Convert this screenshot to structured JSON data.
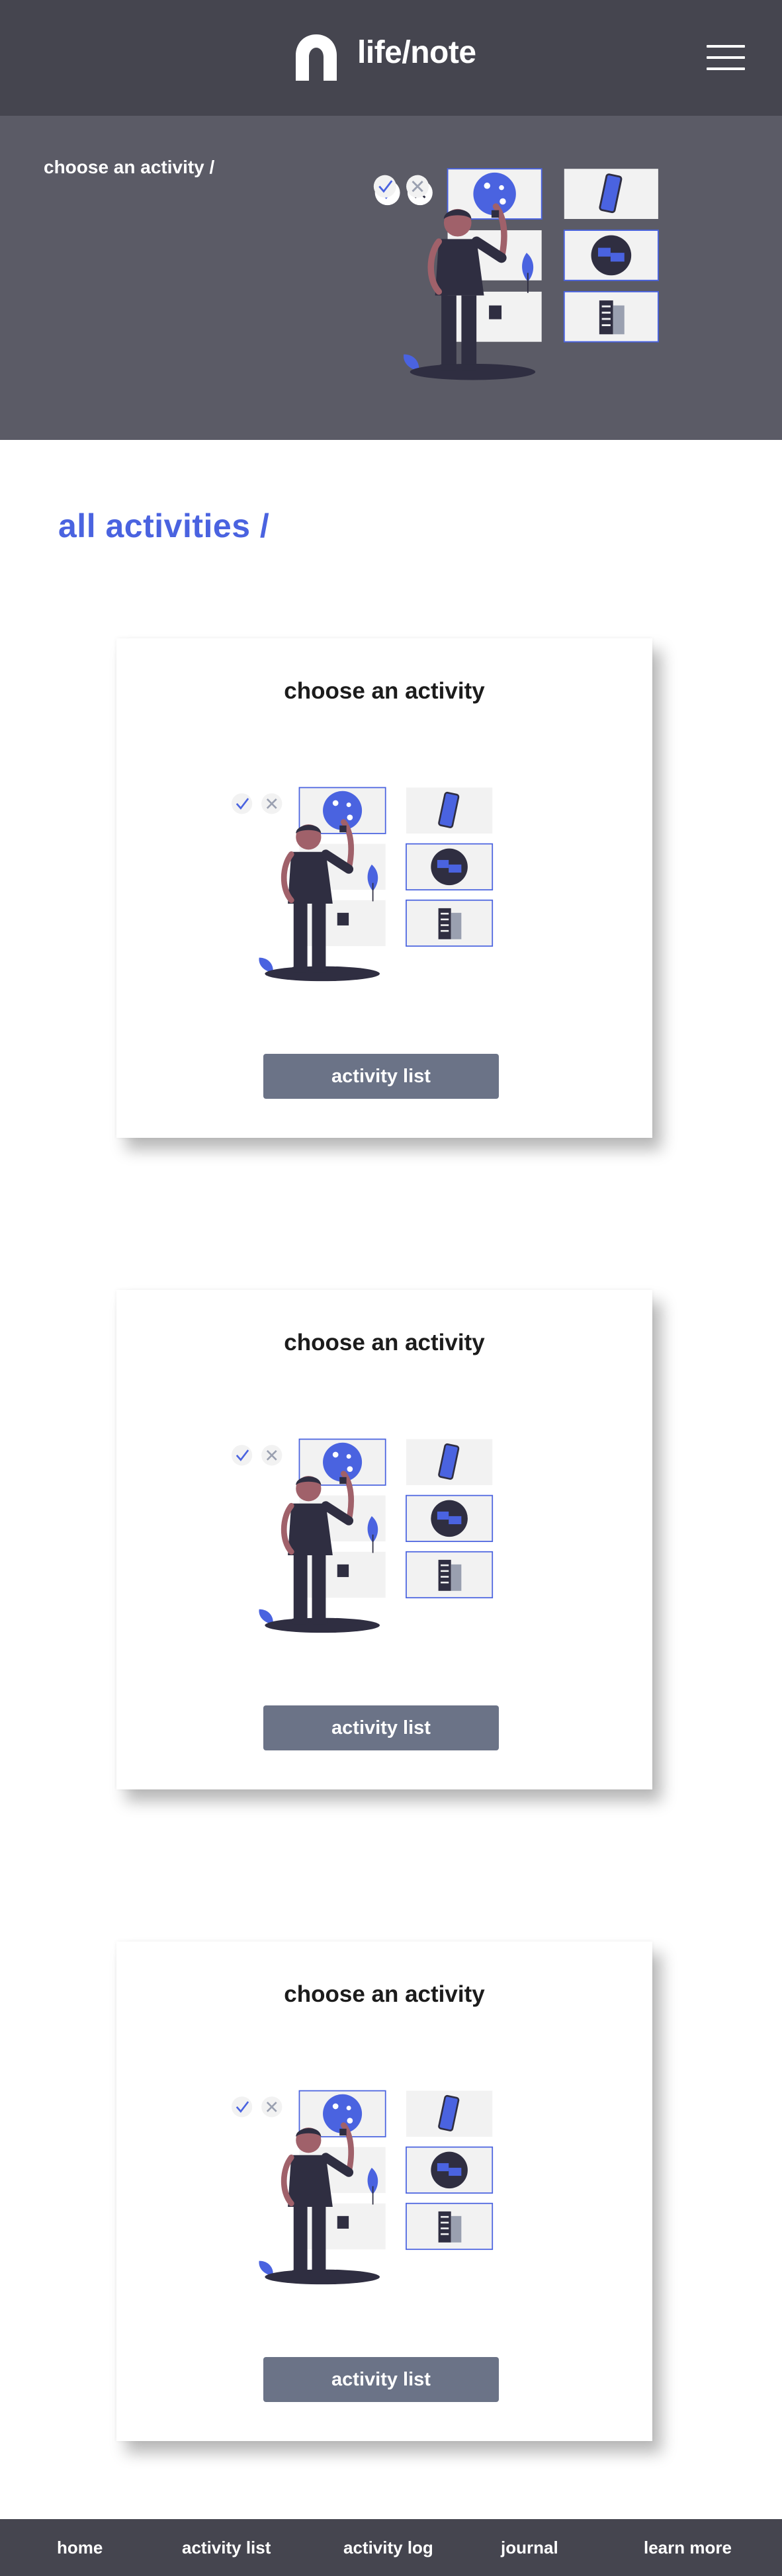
{
  "header": {
    "brand": "life/note",
    "logo_icon": "arch-logo-icon",
    "menu_icon": "hamburger-menu-icon"
  },
  "hero": {
    "label": "choose an activity /"
  },
  "section": {
    "title": "all activities /"
  },
  "cards": [
    {
      "title": "choose an activity",
      "button_label": "activity list"
    },
    {
      "title": "choose an activity",
      "button_label": "activity list"
    },
    {
      "title": "choose an activity",
      "button_label": "activity list"
    }
  ],
  "footer": {
    "links": [
      "home",
      "activity list",
      "activity log",
      "journal",
      "learn more"
    ]
  },
  "colors": {
    "header_bg": "#45454f",
    "hero_bg": "#5b5b66",
    "accent": "#4a63e0",
    "button_bg": "#6b7387",
    "figure_dark": "#2f2e41",
    "panel_bg": "#f2f2f2"
  }
}
